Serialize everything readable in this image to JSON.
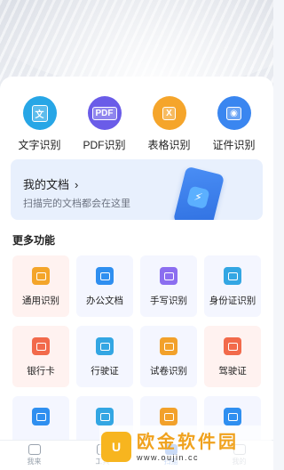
{
  "tools": [
    {
      "label": "文字识别",
      "glyph": "文",
      "icon": "text-scan-icon",
      "color": "#27a6e6"
    },
    {
      "label": "PDF识别",
      "glyph": "PDF",
      "icon": "pdf-icon",
      "color": "#6a5ce8"
    },
    {
      "label": "表格识别",
      "glyph": "X",
      "icon": "table-icon",
      "color": "#f5a52b"
    },
    {
      "label": "证件识别",
      "glyph": "◉",
      "icon": "id-card-icon",
      "color": "#3a86f0"
    }
  ],
  "docs": {
    "title": "我的文档",
    "chevron": "›",
    "subtitle": "扫描完的文档都会在这里"
  },
  "more": {
    "title": "更多功能",
    "items": [
      {
        "label": "通用识别",
        "icon": "general-scan-icon",
        "color": "#f4a52a",
        "warm": true
      },
      {
        "label": "办公文档",
        "icon": "office-doc-icon",
        "color": "#2f8ff0",
        "warm": false
      },
      {
        "label": "手写识别",
        "icon": "handwriting-icon",
        "color": "#8b6ef0",
        "warm": false
      },
      {
        "label": "身份证识别",
        "icon": "id-scan-icon",
        "color": "#33a6e3",
        "warm": false
      },
      {
        "label": "银行卡",
        "icon": "bank-card-icon",
        "color": "#f26a4b",
        "warm": true
      },
      {
        "label": "行驶证",
        "icon": "driving-license-icon",
        "color": "#33a6e3",
        "warm": false
      },
      {
        "label": "试卷识别",
        "icon": "exam-paper-icon",
        "color": "#f2a12b",
        "warm": false
      },
      {
        "label": "驾驶证",
        "icon": "driver-license-icon",
        "color": "#f26a4b",
        "warm": true
      },
      {
        "label": "",
        "icon": "card-icon",
        "color": "#2f8ff0",
        "warm": false
      },
      {
        "label": "",
        "icon": "card-icon",
        "color": "#33a6e3",
        "warm": false
      },
      {
        "label": "",
        "icon": "card-icon",
        "color": "#f2a12b",
        "warm": false
      },
      {
        "label": "",
        "icon": "card-icon",
        "color": "#2f8ff0",
        "warm": false
      }
    ]
  },
  "tabbar": [
    {
      "label": "我来",
      "icon": "heart-icon",
      "active": false
    },
    {
      "label": "工具",
      "icon": "tools-icon",
      "active": false
    },
    {
      "label": "扫描",
      "icon": "scan-icon",
      "active": true
    },
    {
      "label": "我的",
      "icon": "user-icon",
      "active": false
    }
  ],
  "watermark": {
    "logo": "U",
    "brand": "欧金软件园",
    "url": "www.oujin.cc"
  }
}
